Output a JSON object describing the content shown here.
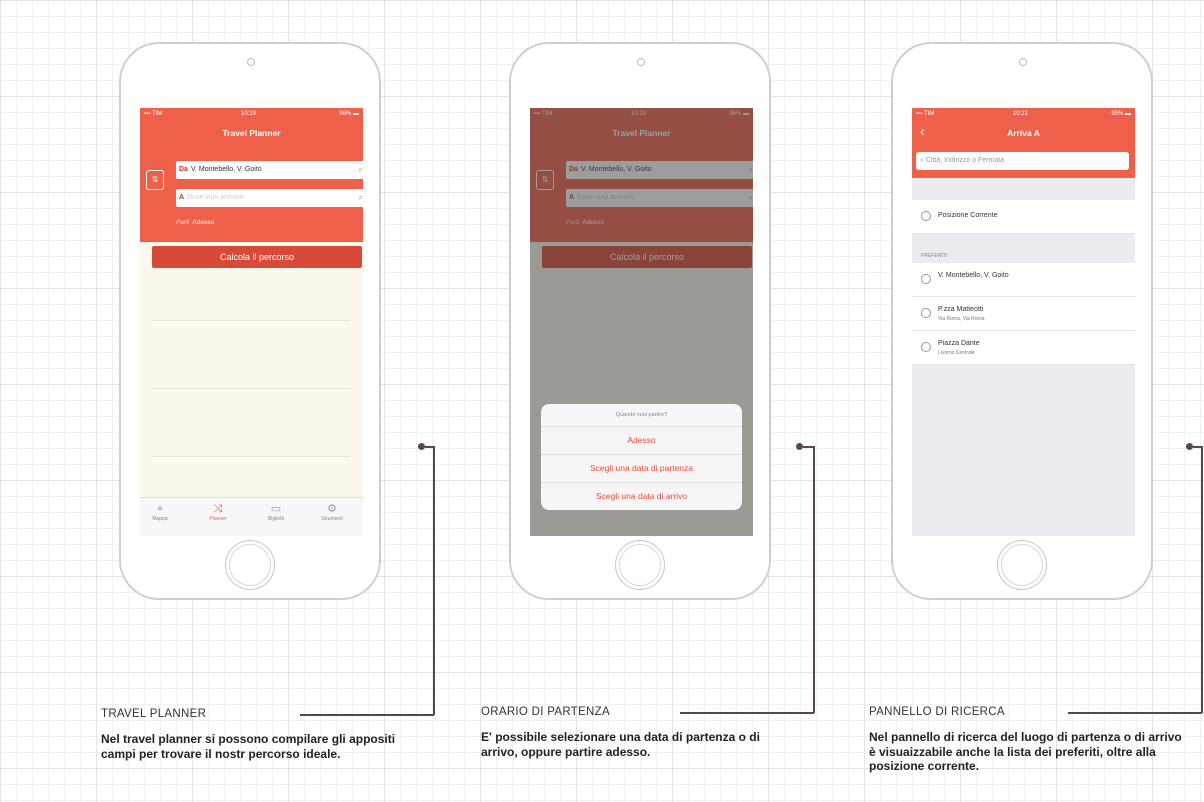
{
  "phone1": {
    "status": {
      "carrier": "TIM",
      "time": "10:19",
      "battery": "96%"
    },
    "title": "Travel Planner",
    "from_prefix": "Da",
    "from_value": "V. Montebello, V. Goito",
    "to_prefix": "A",
    "to_placeholder": "Dove vuoi arrivare",
    "depart_label": "Parti",
    "depart_value": "Adesso",
    "calc_button": "Calcola il percorso",
    "tabs": [
      {
        "label": "Mappa",
        "icon": "map-icon"
      },
      {
        "label": "Planner",
        "icon": "route-icon",
        "active": true
      },
      {
        "label": "Biglietti",
        "icon": "ticket-icon"
      },
      {
        "label": "Strumenti",
        "icon": "gear-icon"
      }
    ]
  },
  "phone2": {
    "status": {
      "carrier": "TIM",
      "time": "10:20",
      "battery": "96%"
    },
    "title": "Travel Planner",
    "from_prefix": "Da",
    "from_value": "V. Montebello, V. Goito",
    "to_prefix": "A",
    "to_placeholder": "Dove vuoi arrivare",
    "depart_label": "Parti",
    "depart_value": "Adesso",
    "calc_button": "Calcola il percorso",
    "sheet": {
      "question": "Quando vuoi partire?",
      "options": [
        "Adesso",
        "Scegli una data di partenza",
        "Scegli una data di arrivo"
      ]
    }
  },
  "phone3": {
    "status": {
      "carrier": "TIM",
      "time": "10:21",
      "battery": "95%"
    },
    "title": "Arriva A",
    "search_placeholder": "Città, Indirizzo o Fermata",
    "current_position": "Posizione Corrente",
    "favorites_label": "PREFERITI",
    "favorites": [
      {
        "name": "V. Montebello, V. Goito",
        "sub": ""
      },
      {
        "name": "P.zza Matteotti",
        "sub": "Via Roma, Via Roma"
      },
      {
        "name": "Piazza Dante",
        "sub": "Livorno Centrale"
      }
    ]
  },
  "captions": [
    {
      "heading": "TRAVEL PLANNER",
      "text": "Nel travel planner si possono compilare gli appositi campi per trovare il nostr percorso ideale."
    },
    {
      "heading": "ORARIO DI PARTENZA",
      "text": "E' possibile selezionare una data di partenza o di arrivo, oppure partire adesso."
    },
    {
      "heading": "PANNELLO DI RICERCA",
      "text": "Nel pannello di ricerca del luogo di partenza o di arrivo è visuaizzabile anche la lista dei preferiti, oltre alla posizione corrente."
    }
  ],
  "colors": {
    "accent": "#ef604a",
    "accent_dark": "#d84a38",
    "connector": "#5a4747"
  }
}
